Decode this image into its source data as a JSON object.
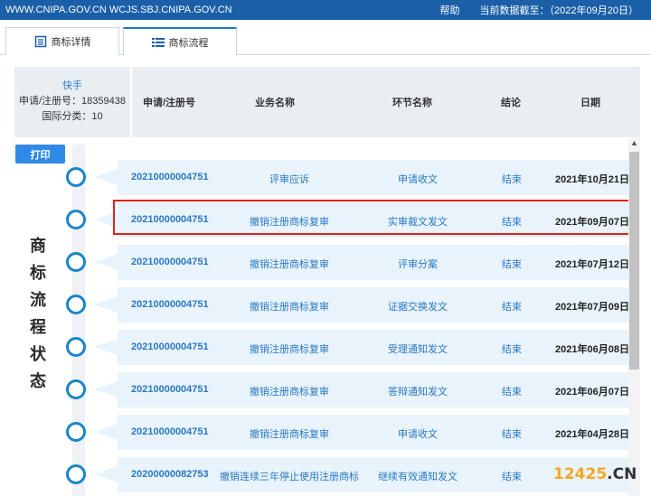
{
  "topbar": {
    "url": "WWW.CNIPA.GOV.CN WCJS.SBJ.CNIPA.GOV.CN",
    "help": "帮助",
    "data_date": "当前数据截至：（2022年09月20日）"
  },
  "tabs": [
    {
      "label": "商标详情",
      "icon": "document-icon"
    },
    {
      "label": "商标流程",
      "icon": "list-icon"
    }
  ],
  "info": {
    "quick": "快手",
    "reg_no": "申请/注册号：18359438",
    "intl_class": "国际分类：10"
  },
  "columns": [
    "申请/注册号",
    "业务名称",
    "环节名称",
    "结论",
    "日期"
  ],
  "print_label": "打印",
  "side_title": "商标流程状态",
  "rows": [
    {
      "no": "20210000004751",
      "business": "评审应诉",
      "step": "申请收文",
      "result": "结束",
      "date": "2021年10月21日"
    },
    {
      "no": "20210000004751",
      "business": "撤销注册商标复审",
      "step": "实审裁文发文",
      "result": "结束",
      "date": "2021年09月07日"
    },
    {
      "no": "20210000004751",
      "business": "撤销注册商标复审",
      "step": "评审分案",
      "result": "结束",
      "date": "2021年07月12日"
    },
    {
      "no": "20210000004751",
      "business": "撤销注册商标复审",
      "step": "证据交换发文",
      "result": "结束",
      "date": "2021年07月09日"
    },
    {
      "no": "20210000004751",
      "business": "撤销注册商标复审",
      "step": "受理通知发文",
      "result": "结束",
      "date": "2021年06月08日"
    },
    {
      "no": "20210000004751",
      "business": "撤销注册商标复审",
      "step": "答辩通知发文",
      "result": "结束",
      "date": "2021年06月07日"
    },
    {
      "no": "20210000004751",
      "business": "撤销注册商标复审",
      "step": "申请收文",
      "result": "结束",
      "date": "2021年04月28日"
    },
    {
      "no": "20200000082753",
      "business": "撤销连续三年停止使用注册商标",
      "step": "继续有效通知发文",
      "result": "结束",
      "date": ""
    }
  ],
  "highlighted_row": 1,
  "watermark": {
    "part1": "12425",
    "part2": ".CN"
  },
  "colors": {
    "topbar": "#1a5fa8",
    "accent": "#2a79c4",
    "highlight": "#e02020",
    "dot": "#1a86c9"
  }
}
